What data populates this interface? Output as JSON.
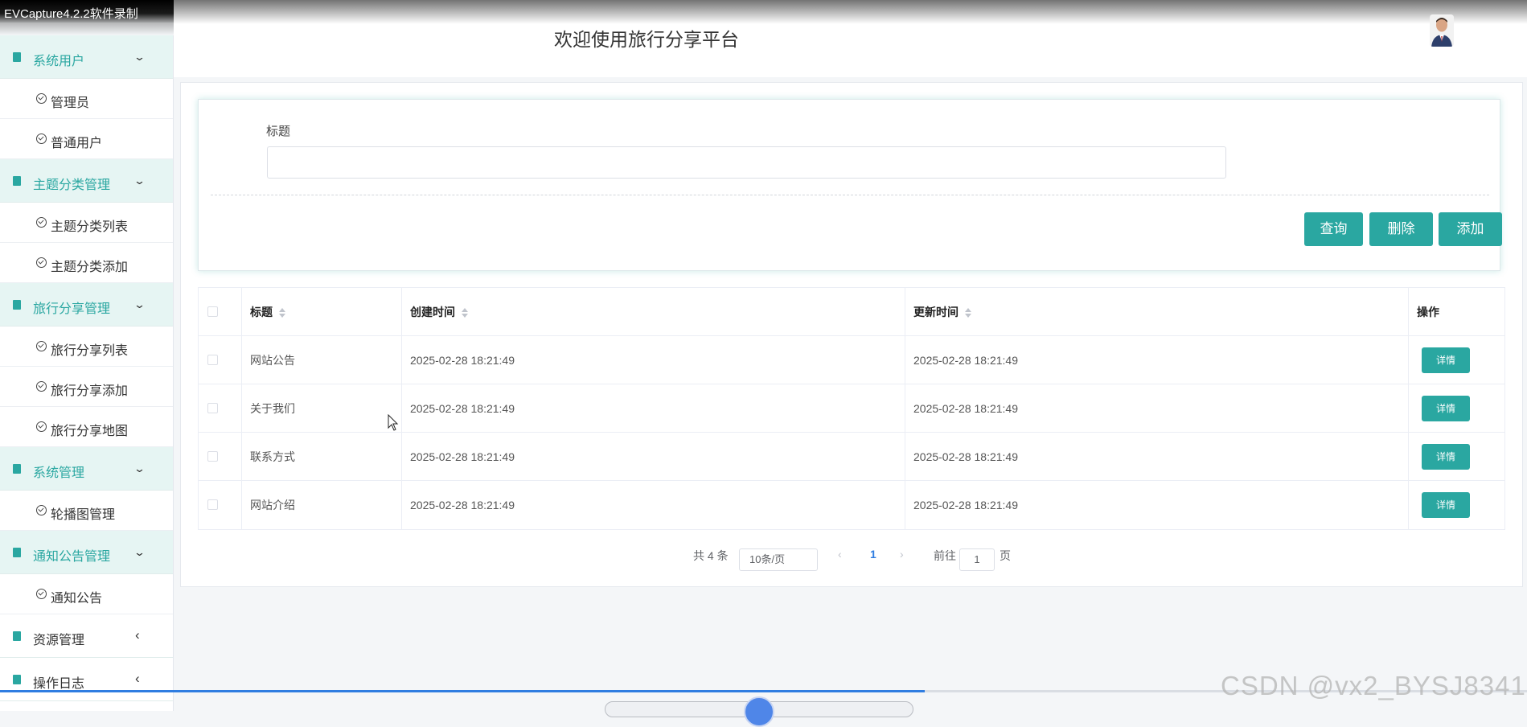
{
  "recorder": {
    "title": "EVCapture4.2.2软件录制"
  },
  "header": {
    "title": "欢迎使用旅行分享平台"
  },
  "sidebar": {
    "groups": [
      {
        "label": "系统用户",
        "items": [
          "管理员",
          "普通用户"
        ]
      },
      {
        "label": "主题分类管理",
        "items": [
          "主题分类列表",
          "主题分类添加"
        ]
      },
      {
        "label": "旅行分享管理",
        "items": [
          "旅行分享列表",
          "旅行分享添加",
          "旅行分享地图"
        ]
      },
      {
        "label": "系统管理",
        "items": [
          "轮播图管理"
        ]
      },
      {
        "label": "通知公告管理",
        "items": [
          "通知公告"
        ]
      }
    ],
    "extra": [
      "资源管理",
      "操作日志"
    ]
  },
  "search": {
    "label": "标题",
    "value": "",
    "buttons": {
      "query": "查询",
      "delete": "删除",
      "add": "添加"
    }
  },
  "table": {
    "headers": {
      "title": "标题",
      "created": "创建时间",
      "updated": "更新时间",
      "action": "操作"
    },
    "rows": [
      {
        "title": "网站公告",
        "created": "2025-02-28 18:21:49",
        "updated": "2025-02-28 18:21:49",
        "action": "详情"
      },
      {
        "title": "关于我们",
        "created": "2025-02-28 18:21:49",
        "updated": "2025-02-28 18:21:49",
        "action": "详情"
      },
      {
        "title": "联系方式",
        "created": "2025-02-28 18:21:49",
        "updated": "2025-02-28 18:21:49",
        "action": "详情"
      },
      {
        "title": "网站介绍",
        "created": "2025-02-28 18:21:49",
        "updated": "2025-02-28 18:21:49",
        "action": "详情"
      }
    ]
  },
  "pagination": {
    "total": "共 4 条",
    "page_size": "10条/页",
    "current": "1",
    "goto_prefix": "前往",
    "goto_value": "1",
    "goto_suffix": "页"
  },
  "watermark": "CSDN @vx2_BYSJ8341",
  "colors": {
    "accent": "#2aa7a1",
    "group_bg": "#e6f5f3",
    "progress": "#2f7de1"
  }
}
